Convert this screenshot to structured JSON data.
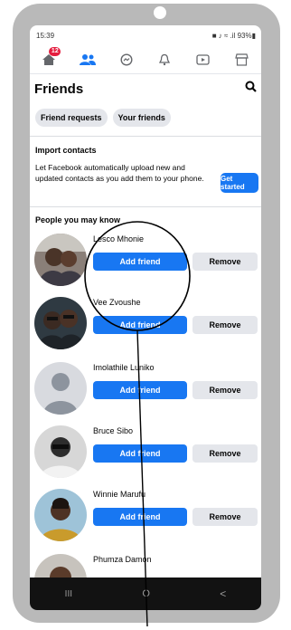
{
  "status_bar": {
    "time": "15:39",
    "indicators": "■ ♪ ≈ .il 93%▮"
  },
  "nav_bar": {
    "tabs": [
      {
        "icon": "home-icon",
        "badge": "12"
      },
      {
        "icon": "friends-icon"
      },
      {
        "icon": "messenger-icon"
      },
      {
        "icon": "notifications-bell-icon"
      },
      {
        "icon": "watch-video-icon"
      },
      {
        "icon": "marketplace-icon"
      }
    ]
  },
  "header": {
    "title": "Friends",
    "search_icon": "search-icon"
  },
  "chips": {
    "friend_requests": "Friend requests",
    "your_friends": "Your friends"
  },
  "import_contacts": {
    "title": "Import contacts",
    "text": "Let Facebook automatically upload new and updated contacts as you add them to your phone.",
    "button": "Get started"
  },
  "people_you_may_know": {
    "title": "People you may know",
    "add_label": "Add friend",
    "remove_label": "Remove",
    "people": [
      {
        "name": "Lesco Mhonie"
      },
      {
        "name": "Vee Zvoushe"
      },
      {
        "name": "Imolathile Luniko"
      },
      {
        "name": "Bruce Sibo"
      },
      {
        "name": "Winnie Marufu"
      },
      {
        "name": "Phumza Damon"
      }
    ]
  },
  "system_nav": {
    "recents": "III",
    "home": "O",
    "back": "<"
  },
  "colors": {
    "accent": "#1877f2",
    "badge": "#e41e3f",
    "frame": "#b9b9b9",
    "nav": "#121212"
  }
}
